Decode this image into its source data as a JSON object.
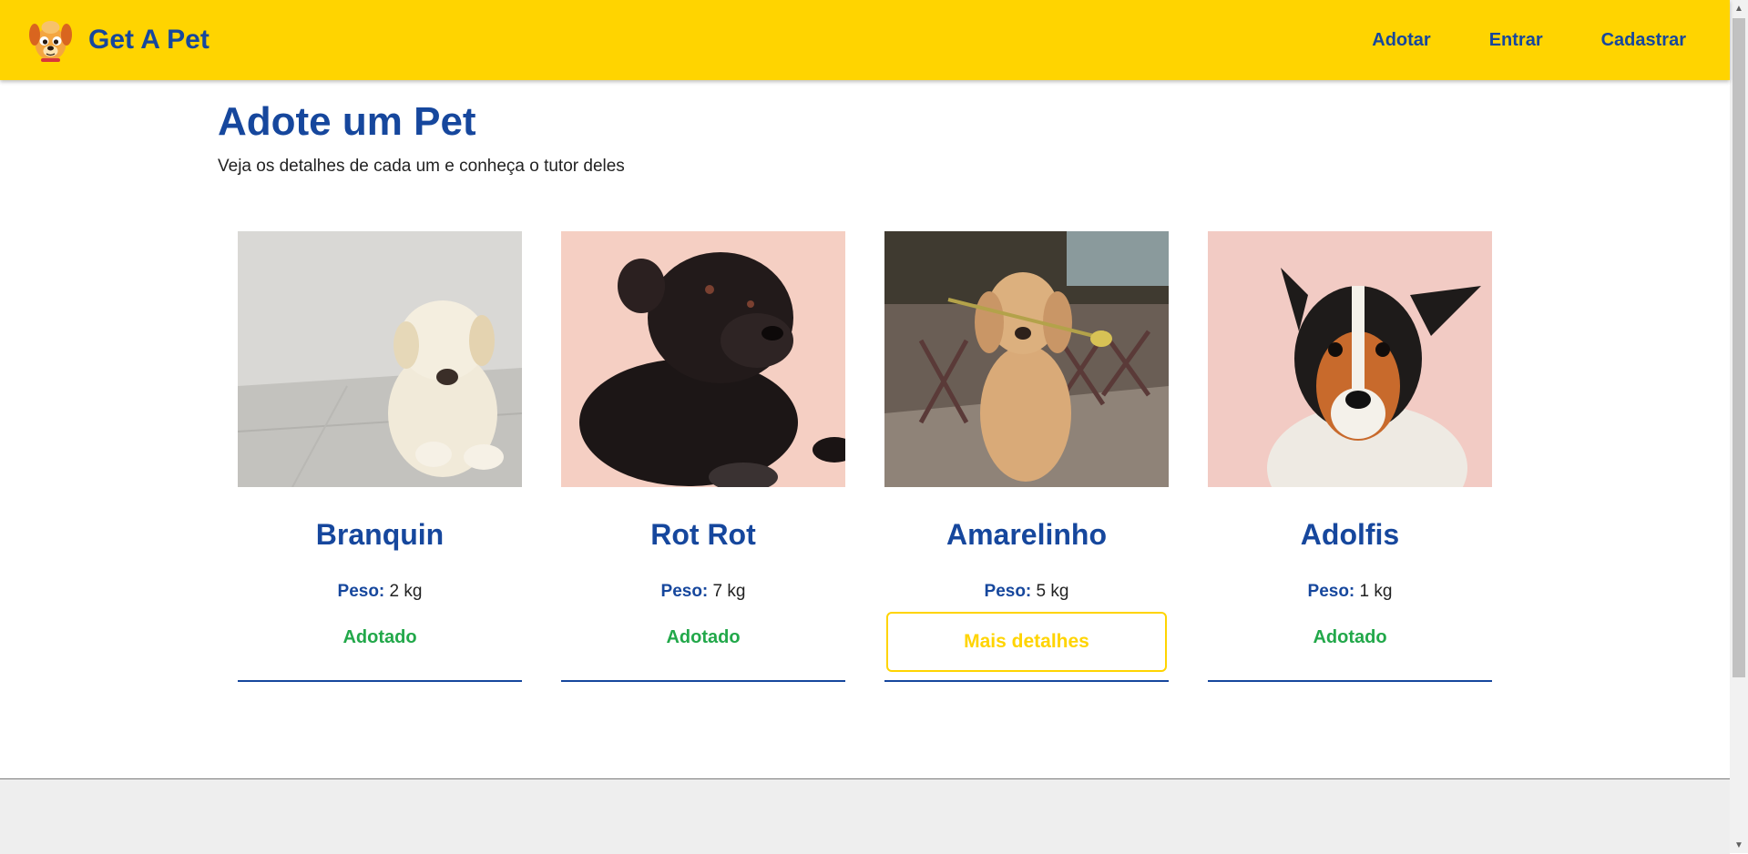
{
  "brand": {
    "title": "Get A Pet",
    "logo_icon": "dog-face-icon"
  },
  "nav": {
    "items": [
      {
        "label": "Adotar"
      },
      {
        "label": "Entrar"
      },
      {
        "label": "Cadastrar"
      }
    ]
  },
  "main": {
    "title": "Adote um Pet",
    "subtitle": "Veja os detalhes de cada um e conheça o tutor deles"
  },
  "pets": [
    {
      "name": "Branquin",
      "weight_label": "Peso:",
      "weight": "2 kg",
      "status": "Adotado",
      "photo_icon": "cream-puppy-photo"
    },
    {
      "name": "Rot Rot",
      "weight_label": "Peso:",
      "weight": "7 kg",
      "status": "Adotado",
      "photo_icon": "black-dog-photo"
    },
    {
      "name": "Amarelinho",
      "weight_label": "Peso:",
      "weight": "5 kg",
      "action": "Mais detalhes",
      "photo_icon": "golden-dog-with-flower-photo"
    },
    {
      "name": "Adolfis",
      "weight_label": "Peso:",
      "weight": "1 kg",
      "status": "Adotado",
      "photo_icon": "terrier-dog-photo"
    }
  ],
  "colors": {
    "navbar": "#ffd400",
    "primary": "#16479d",
    "adopted": "#22a84a",
    "footer": "#eeeeee"
  }
}
